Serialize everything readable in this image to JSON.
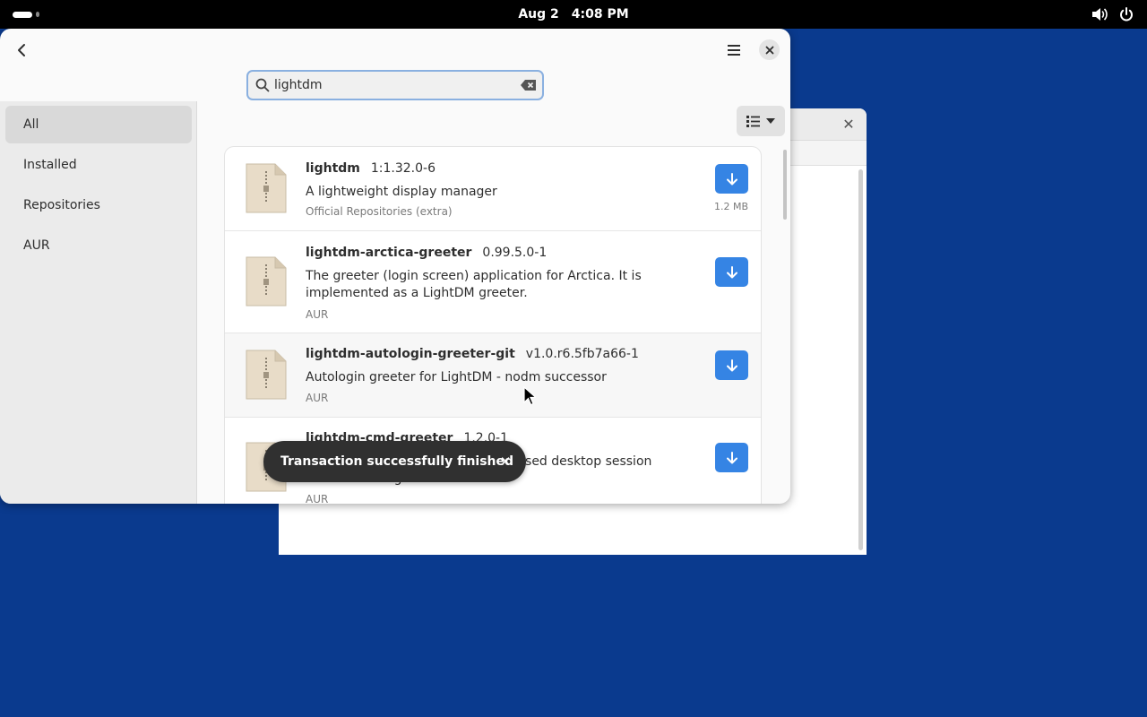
{
  "topbar": {
    "date": "Aug 2",
    "time": "4:08 PM"
  },
  "search": {
    "value": "lightdm"
  },
  "sidebar": {
    "items": [
      {
        "label": "All",
        "active": true
      },
      {
        "label": "Installed",
        "active": false
      },
      {
        "label": "Repositories",
        "active": false
      },
      {
        "label": "AUR",
        "active": false
      }
    ]
  },
  "packages": [
    {
      "name": "lightdm",
      "version": "1:1.32.0-6",
      "description": "A lightweight display manager",
      "repository": "Official Repositories (extra)",
      "size": "1.2 MB"
    },
    {
      "name": "lightdm-arctica-greeter",
      "version": "0.99.5.0-1",
      "description": "The greeter (login screen) application for Arctica. It is implemented as a LightDM greeter.",
      "repository": "AUR"
    },
    {
      "name": "lightdm-autologin-greeter-git",
      "version": "v1.0.r6.5fb7a66-1",
      "description": "Autologin greeter for LightDM - nodm successor",
      "repository": "AUR"
    },
    {
      "name": "lightdm-cmd-greeter",
      "version": "1.2.0-1",
      "description": "A lightdm greeter for a terminal based desktop session launcher via lightdm",
      "repository": "AUR"
    }
  ],
  "toast": {
    "message": "Transaction successfully finished"
  },
  "colors": {
    "accent": "#3584e4",
    "desktop": "#0a3a8e",
    "toast_bg": "#303030"
  },
  "icons": {
    "back": "back-arrow-icon",
    "menu": "hamburger-menu-icon",
    "close": "close-icon",
    "search": "search-icon",
    "clear": "clear-input-icon",
    "view": "list-view-icon",
    "download": "download-arrow-icon",
    "package": "archive-package-icon",
    "volume": "volume-icon",
    "power": "power-icon"
  }
}
